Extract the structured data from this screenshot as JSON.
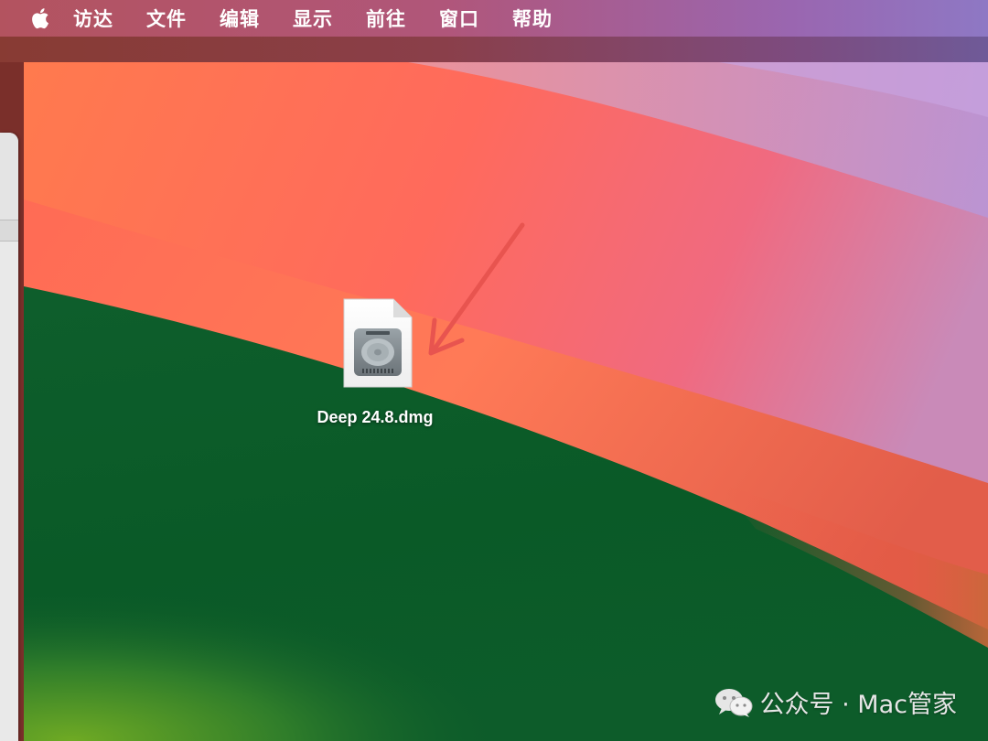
{
  "menubar": {
    "apple_icon": "apple-logo-icon",
    "items": [
      "访达",
      "文件",
      "编辑",
      "显示",
      "前往",
      "窗口",
      "帮助"
    ]
  },
  "desktop": {
    "file": {
      "name": "Deep 24.8.dmg",
      "icon": "disk-image-file-icon"
    }
  },
  "annotation": {
    "arrow_color": "#e8544f"
  },
  "watermark": {
    "icon": "wechat-icon",
    "text": "公众号 · Mac管家"
  }
}
